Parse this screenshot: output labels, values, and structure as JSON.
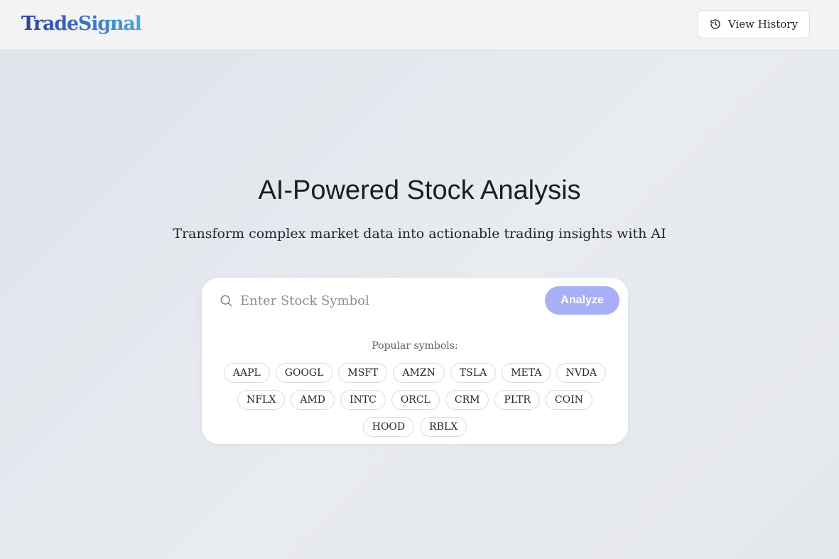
{
  "header": {
    "logo_text": "TradeSignal",
    "history_button_label": "View History",
    "history_icon": "history-icon"
  },
  "hero": {
    "title": "AI-Powered Stock Analysis",
    "subtitle": "Transform complex market data into actionable trading insights with AI"
  },
  "search": {
    "placeholder": "Enter Stock Symbol",
    "value": "",
    "icon": "search-icon",
    "button_label": "Analyze",
    "button_color": "#a7b0f5"
  },
  "popular": {
    "label": "Popular symbols:",
    "symbols": [
      "AAPL",
      "GOOGL",
      "MSFT",
      "AMZN",
      "TSLA",
      "META",
      "NVDA",
      "NFLX",
      "AMD",
      "INTC",
      "ORCL",
      "CRM",
      "PLTR",
      "COIN",
      "HOOD",
      "RBLX"
    ]
  }
}
